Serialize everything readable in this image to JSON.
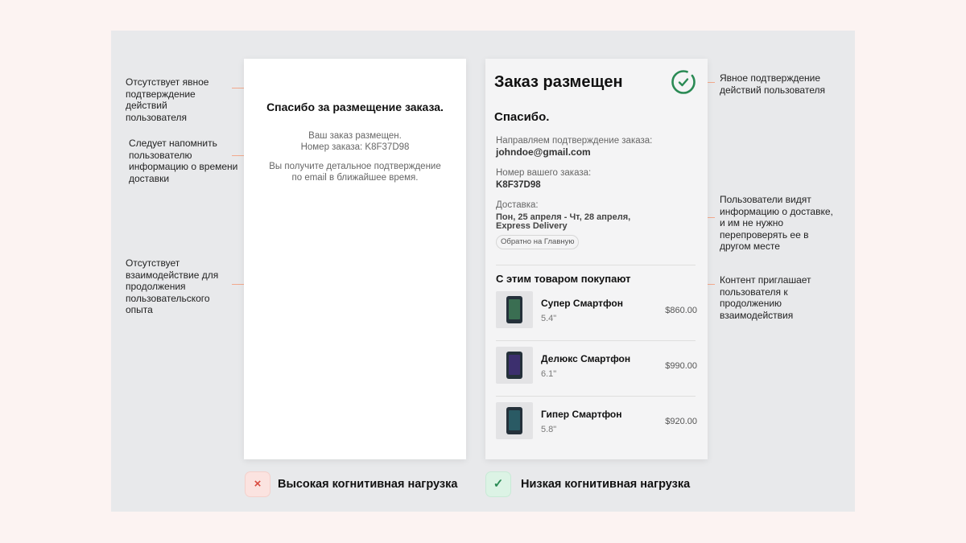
{
  "annotations_left": [
    {
      "text": "Отсутствует явное подтверждение действий пользователя"
    },
    {
      "text": "Следует напомнить пользователю информацию о времени доставки"
    },
    {
      "text": "Отсутствует взаимодействие для продолжения пользовательского опыта"
    }
  ],
  "annotations_right": [
    {
      "text": "Явное подтверждение действий пользователя"
    },
    {
      "text": "Пользователи видят информацию о доставке, и им не нужно перепроверять ее в другом месте"
    },
    {
      "text": "Контент приглашает пользователя к продолжению взаимодействия"
    }
  ],
  "bad_screen": {
    "title": "Спасибо за размещение заказа.",
    "line1": "Ваш заказ размещен.",
    "line2": "Номер заказа: K8F37D98",
    "line3": "Вы получите детальное подтверждение",
    "line4": "по email в ближайшее время."
  },
  "good_screen": {
    "title": "Заказ размещен",
    "check_icon": "check-circle-icon",
    "thanks": "Спасибо.",
    "confirm_label": "Направляем подтверждение заказа:",
    "email": "johndoe@gmail.com",
    "order_label": "Номер вашего заказа:",
    "order_number": "K8F37D98",
    "delivery_label": "Доставка:",
    "delivery_dates": "Пон, 25 апреля - Чт, 28 апреля,",
    "delivery_method": "Express Delivery",
    "back_button": "Обратно на Главную",
    "recommend_title": "С этим товаром покупают",
    "products": [
      {
        "name": "Супер Смартфон",
        "size": "5.4\"",
        "price": "$860.00"
      },
      {
        "name": "Делюкс Смартфон",
        "size": "6.1\"",
        "price": "$990.00"
      },
      {
        "name": "Гипер Смартфон",
        "size": "5.8\"",
        "price": "$920.00"
      }
    ]
  },
  "labels": {
    "bad_icon": "×",
    "bad_caption": "Высокая когнитивная нагрузка",
    "good_icon": "✓",
    "good_caption": "Низкая когнитивная нагрузка"
  },
  "colors": {
    "background": "#fcf3f2",
    "stage": "#e8e9eb",
    "connector": "#f2a98c",
    "success": "#2a8a54",
    "error": "#d94a3f"
  }
}
